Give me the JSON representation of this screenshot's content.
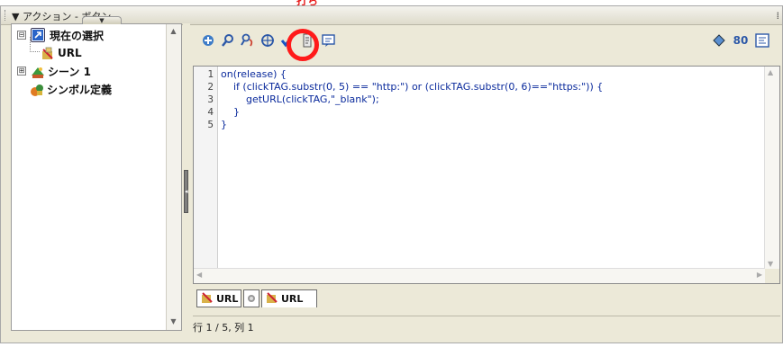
{
  "annotation": {
    "text": "打ち"
  },
  "panel": {
    "title": "▼ アクション - ボタン"
  },
  "tree": {
    "items": [
      {
        "label": "現在の選択",
        "toggle": "⊟"
      },
      {
        "label": "URL"
      },
      {
        "label": "シーン 1",
        "toggle": "⊞"
      },
      {
        "label": "シンボル定義"
      }
    ]
  },
  "toolbar": {
    "icons": [
      "add-statement-icon",
      "find-icon",
      "replace-icon",
      "target-path-icon",
      "check-syntax-icon",
      "auto-format-icon",
      "code-hint-icon",
      "debug-options-icon",
      "reference-icon",
      "view-options-icon"
    ],
    "right_label": "80"
  },
  "code": {
    "line_numbers": [
      "1",
      "2",
      "3",
      "4",
      "5"
    ],
    "lines": [
      "on(release) {",
      "    if (clickTAG.substr(0, 5) == \"http:\") or (clickTAG.substr(0, 6)==\"https:\")) {",
      "        getURL(clickTAG,\"_blank\");",
      "    }",
      "}"
    ]
  },
  "tabs": [
    {
      "label": "URL"
    },
    {
      "label": "URL"
    }
  ],
  "status": {
    "text": "行 1 / 5, 列 1"
  },
  "colors": {
    "annotation": "#e81c1c",
    "highlight_circle": "#ff1a1a",
    "code_text": "#0a2a9c"
  }
}
